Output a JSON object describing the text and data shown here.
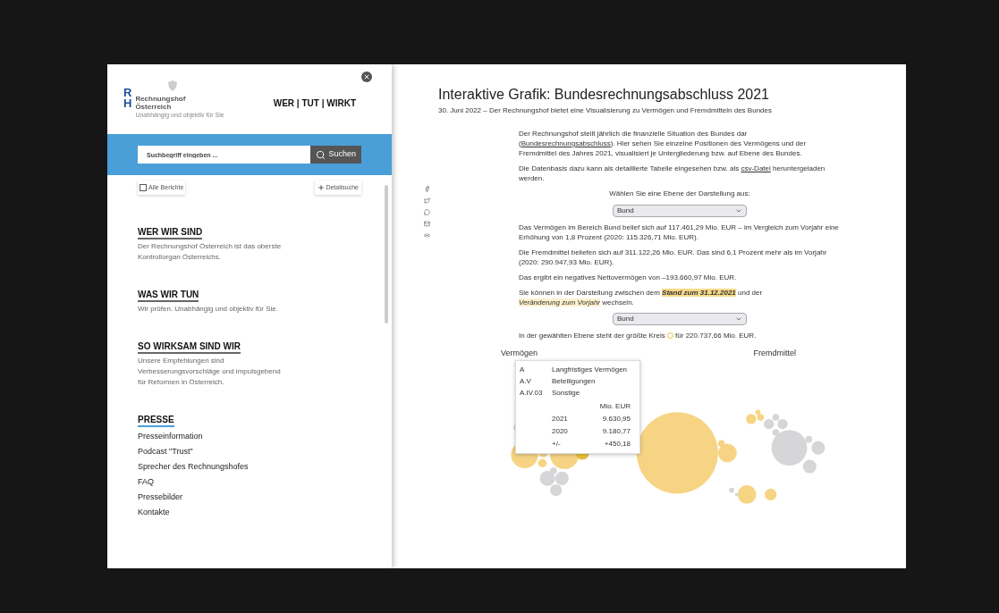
{
  "sidebar": {
    "logo": {
      "letters": [
        "R",
        "H"
      ],
      "name_lines": [
        "Rechnungshof",
        "Österreich"
      ],
      "tagline": "Unabhängig und objektiv für Sie"
    },
    "slogan": "WER | TUT | WIRKT",
    "search": {
      "placeholder": "Suchbegriff eingeben ...",
      "button": "Suchen"
    },
    "all_reports": {
      "label": "Alle Berichte",
      "checked": false
    },
    "detail_search": "Detailsuche",
    "sections": [
      {
        "title": "WER WIR SIND",
        "text": "Der Rechnungshof Österreich ist das oberste Kontrollorgan Österreichs."
      },
      {
        "title": "WAS WIR TUN",
        "text": "Wir prüfen. Unabhängig und objektiv für Sie."
      },
      {
        "title": "SO WIRKSAM SIND WIR",
        "text": "Unsere Empfehlungen sind Verbesserungsvorschläge und impulsgebend für Reformen in Österreich."
      }
    ],
    "press": {
      "title": "PRESSE",
      "links": [
        "Presseinformation",
        "Podcast \"Trust\"",
        "Sprecher des Rechnungshofes",
        "FAQ",
        "Pressebilder",
        "Kontakte"
      ]
    }
  },
  "article": {
    "title": "Interaktive Grafik: Bundesrechnungsabschluss 2021",
    "subtitle": "30. Juni 2022 – Der Rechnungshof bietet eine Visualisierung zu Vermögen und Fremdmitteln des Bundes",
    "share": [
      {
        "kind": "facebook"
      },
      {
        "kind": "twitter"
      },
      {
        "kind": "whatsapp"
      },
      {
        "kind": "mail"
      },
      {
        "kind": "link"
      }
    ],
    "blocks": [
      {
        "kind": "paragraph",
        "parts": [
          {
            "kind": "text",
            "text": "Der Rechnungshof stellt jährlich die finanzielle Situation des Bundes dar ("
          },
          {
            "kind": "link",
            "text": "Bundesrechnungsabschluss"
          },
          {
            "kind": "text",
            "text": "). Hier sehen Sie einzelne Positionen des Vermögens und der Fremdmittel des Jahres 2021, visualisiert je Untergliederung bzw. auf Ebene des Bundes."
          }
        ]
      },
      {
        "kind": "paragraph",
        "parts": [
          {
            "kind": "text",
            "text": "Die Datenbasis dazu kann als detaillierte Tabelle eingesehen bzw. als "
          },
          {
            "kind": "link",
            "text": "csv-Datei"
          },
          {
            "kind": "text",
            "text": " heruntergeladen werden."
          }
        ]
      },
      {
        "kind": "caption",
        "text": "Wählen Sie eine Ebene der Darstellung aus:"
      },
      {
        "kind": "select",
        "value": "Bund"
      },
      {
        "kind": "paragraph",
        "parts": [
          {
            "kind": "text",
            "text": "Das Vermögen im Bereich Bund belief sich auf 117.461,29 Mio. EUR – im Vergleich zum Vorjahr eine Erhöhung von 1,8 Prozent (2020: 115.326,71 Mio. EUR)."
          }
        ]
      },
      {
        "kind": "paragraph",
        "parts": [
          {
            "kind": "text",
            "text": "Die Fremdmittel beliefen sich auf 311.122,26 Mio. EUR. Das sind 6,1 Prozent mehr als im Vorjahr (2020: 290.947,93 Mio. EUR)."
          }
        ]
      },
      {
        "kind": "paragraph",
        "parts": [
          {
            "kind": "text",
            "text": "Das ergibt ein negatives Nettovermögen von –193.660,97 Mio. EUR."
          }
        ]
      },
      {
        "kind": "paragraph",
        "parts": [
          {
            "kind": "text",
            "text": "Sie können in der Darstellung zwischen dem "
          },
          {
            "kind": "highlight",
            "text": "Stand zum 31.12.2021",
            "selected": true
          },
          {
            "kind": "text",
            "text": " und der "
          },
          {
            "kind": "highlight",
            "text": "Veränderung zum Vorjahr",
            "selected": false
          },
          {
            "kind": "text",
            "text": " wechseln."
          }
        ]
      },
      {
        "kind": "select",
        "value": "Bund"
      },
      {
        "kind": "paragraph",
        "parts": [
          {
            "kind": "text",
            "text": "In der gewählten Ebene steht der größte Kreis "
          },
          {
            "kind": "circle"
          },
          {
            "kind": "text",
            "text": " für 220.737,66 Mio. EUR."
          }
        ]
      }
    ],
    "chart": {
      "left_label": "Vermögen",
      "right_label": "Fremdmittel",
      "tooltip": {
        "path": [
          {
            "code": "A",
            "name": "Langfristiges Vermögen"
          },
          {
            "code": "A.V",
            "name": "Beteiligungen"
          },
          {
            "code": "A.IV.03",
            "name": "Sonstige"
          }
        ],
        "unit": "Mio. EUR",
        "rows": [
          {
            "label": "2021",
            "value": "9.630,95"
          },
          {
            "label": "2020",
            "value": "9.180,77"
          },
          {
            "label": "+/-",
            "value": "+450,18"
          }
        ]
      }
    }
  }
}
